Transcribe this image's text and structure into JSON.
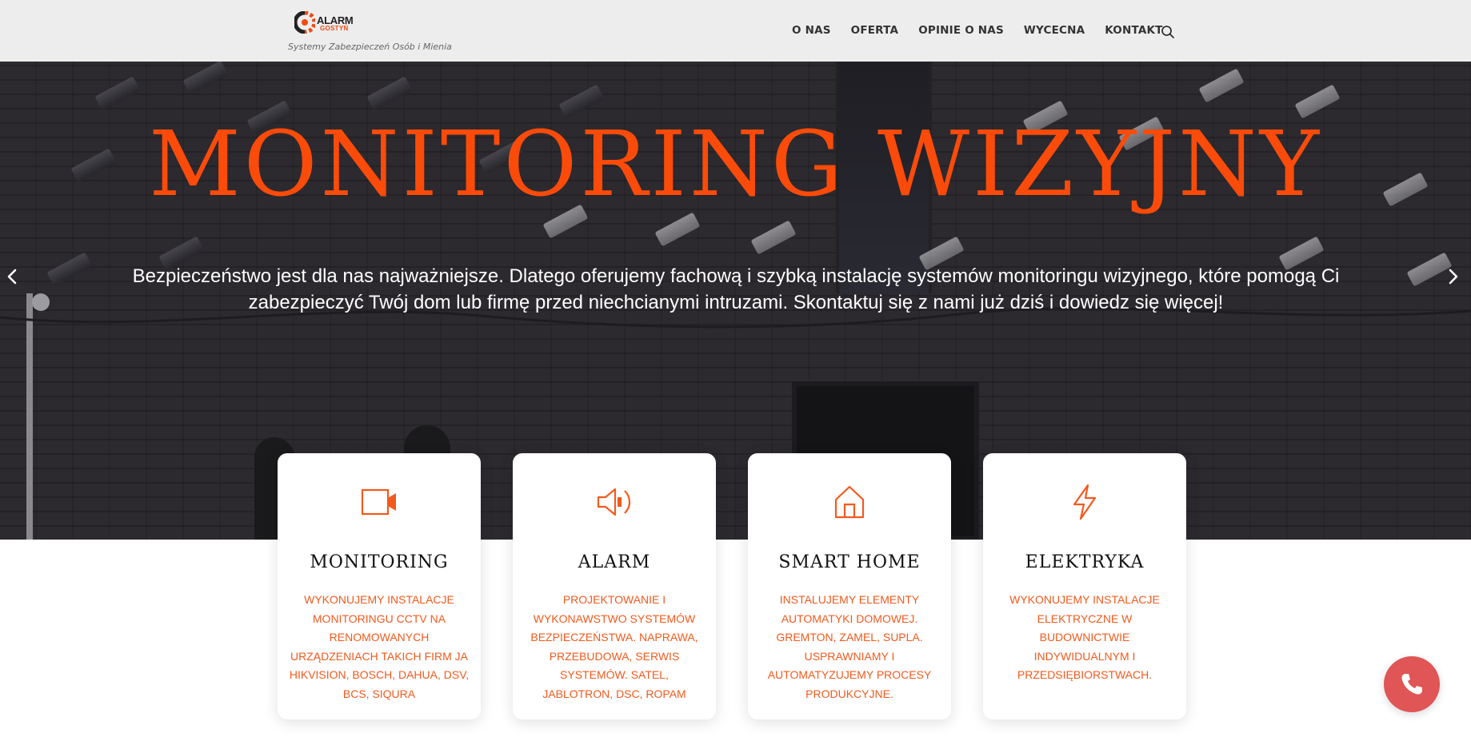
{
  "colors": {
    "accent": "#fb4b0a",
    "card_text": "#f25a1d",
    "header_bg": "#ededed",
    "phone_button": "#e05555"
  },
  "header": {
    "logo_word1": "ALARM",
    "logo_word2": "GOSTYŃ",
    "tagline": "Systemy Zabezpieczeń Osób i Mienia",
    "nav": [
      "O NAS",
      "OFERTA",
      "OPINIE O NAS",
      "WYCECNA",
      "KONTAKT"
    ],
    "search_icon": "search-icon"
  },
  "hero": {
    "title": "MONITORING WIZYJNY",
    "description": "Bezpieczeństwo jest dla nas najważniejsze. Dlatego oferujemy fachową i szybką instalację systemów monitoringu wizyjnego, które pomogą Ci zabezpieczyć Twój dom lub firmę przed niechcianymi intruzami. Skontaktuj się z nami już dziś i dowiedz się więcej!",
    "prev_icon": "chevron-left-icon",
    "next_icon": "chevron-right-icon"
  },
  "cards": [
    {
      "icon": "video-camera-icon",
      "title": "MONITORING",
      "text": "WYKONUJEMY INSTALACJE MONITORINGU CCTV NA RENOMOWANYCH URZĄDZENIACH TAKICH FIRM JA HIKVISION, BOSCH, DAHUA, DSV, BCS, SIQURA"
    },
    {
      "icon": "speaker-icon",
      "title": "ALARM",
      "text": "PROJEKTOWANIE I WYKONAWSTWO SYSTEMÓW BEZPIECZEŃSTWA. NAPRAWA, PRZEBUDOWA, SERWIS SYSTEMÓW. SATEL, JABLOTRON, DSC, ROPAM"
    },
    {
      "icon": "home-icon",
      "title": "SMART HOME",
      "text": "INSTALUJEMY ELEMENTY AUTOMATYKI DOMOWEJ. GREMTON, ZAMEL, SUPLA. USPRAWNIAMY I AUTOMATYZUJEMY PROCESY PRODUKCYJNE."
    },
    {
      "icon": "lightning-icon",
      "title": "ELEKTRYKA",
      "text": "WYKONUJEMY INSTALACJE ELEKTRYCZNE W BUDOWNICTWIE INDYWIDUALNYM I PRZEDSIĘBIORSTWACH."
    }
  ],
  "phone_icon": "phone-icon"
}
